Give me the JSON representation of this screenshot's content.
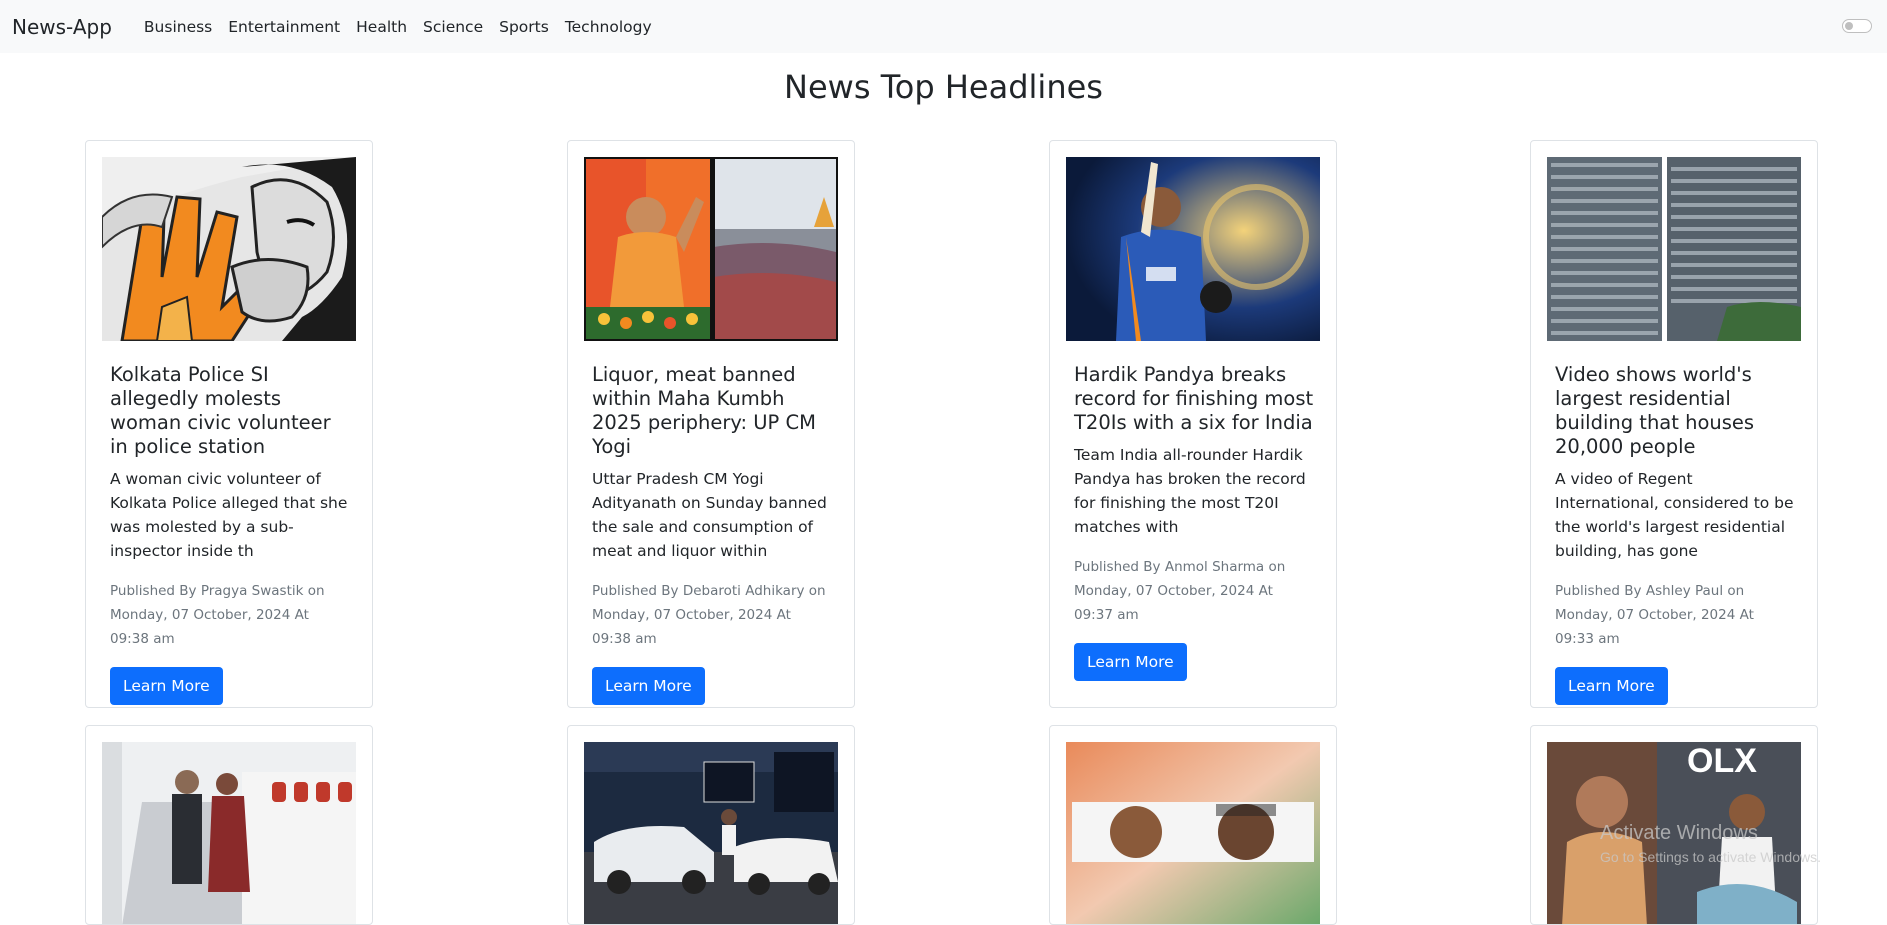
{
  "navbar": {
    "brand": "News-App",
    "links": [
      "Business",
      "Entertainment",
      "Health",
      "Science",
      "Sports",
      "Technology"
    ]
  },
  "page_title": "News Top Headlines",
  "cards": [
    {
      "image": "assault-illustration",
      "title": "Kolkata Police SI allegedly molests woman civic volunteer in police station",
      "description": "A woman civic volunteer of Kolkata Police alleged that she was molested by a sub-inspector inside th",
      "meta": "Published By Pragya Swastik on Monday, 07 October, 2024 At 09:38 am",
      "button": "Learn More"
    },
    {
      "image": "yogi-and-kumbh-crowd",
      "title": "Liquor, meat banned within Maha Kumbh 2025 periphery: UP CM Yogi",
      "description": "Uttar Pradesh CM Yogi Adityanath on Sunday banned the sale and consumption of meat and liquor within",
      "meta": "Published By Debaroti Adhikary on Monday, 07 October, 2024 At 09:38 am",
      "button": "Learn More"
    },
    {
      "image": "cricketer-raising-bat",
      "title": "Hardik Pandya breaks record for finishing most T20Is with a six for India",
      "description": "Team India all-rounder Hardik Pandya has broken the record for finishing the most T20I matches with",
      "meta": "Published By Anmol Sharma on Monday, 07 October, 2024 At 09:37 am",
      "button": "Learn More"
    },
    {
      "image": "residential-building",
      "title": "Video shows world's largest residential building that houses 20,000 people",
      "description": "A video of Regent International, considered to be the world's largest residential building, has gone",
      "meta": "Published By Ashley Paul on Monday, 07 October, 2024 At 09:33 am",
      "button": "Learn More"
    },
    {
      "image": "aircraft-stairs-dignitaries"
    },
    {
      "image": "car-studio"
    },
    {
      "image": "two-politicians"
    },
    {
      "image": "olx-founders"
    }
  ],
  "watermark": {
    "line1": "Activate Windows",
    "line2": "Go to Settings to activate Windows."
  },
  "colors": {
    "navbar_bg": "#f8f9fa",
    "button": "#0d6efd",
    "meta_text": "#6c757d"
  }
}
